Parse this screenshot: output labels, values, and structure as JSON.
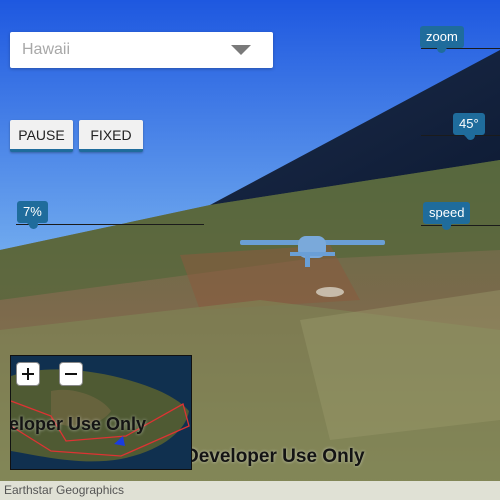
{
  "location_select": {
    "selected": "Hawaii",
    "caret_icon": "chevron-down-icon"
  },
  "controls": {
    "pause_label": "PAUSE",
    "fixed_label": "FIXED"
  },
  "sliders": {
    "zoom": {
      "label": "zoom",
      "level": 1.0
    },
    "tilt": {
      "label": "45°",
      "level": 0.5
    },
    "pitch": {
      "label": "7%",
      "level": 0.07
    },
    "speed": {
      "label": "speed",
      "level": 0.5
    }
  },
  "watermark": {
    "text": "Developer Use Only"
  },
  "minimap": {
    "zoom_in_icon": "plus-icon",
    "zoom_out_icon": "minus-icon",
    "watermark": "eloper Use Only"
  },
  "attribution": {
    "text": "Earthstar Geographics"
  },
  "colors": {
    "accent": "#1f6c9c",
    "sky_top": "#1f5de2",
    "sky_bottom": "#cfe6f8",
    "terrain": "#6d7a47",
    "plane": "#6a9fd6"
  }
}
